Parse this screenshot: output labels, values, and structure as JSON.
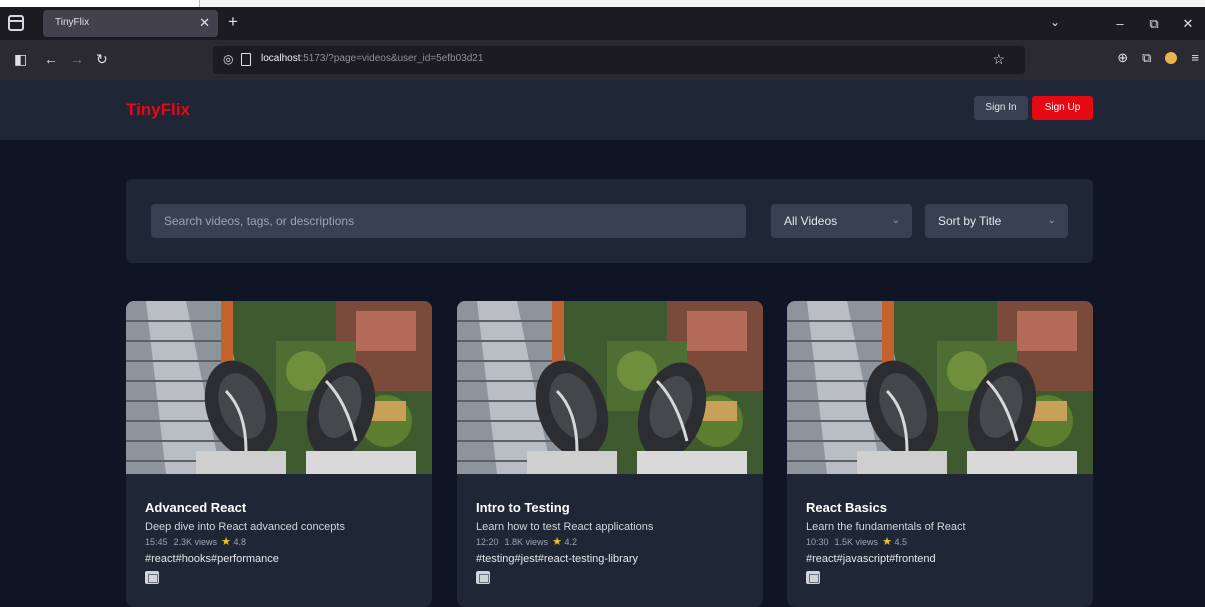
{
  "browser": {
    "tab_title": "TinyFlix",
    "tab_close": "✕",
    "new_tab": "+",
    "url_host": "localhost",
    "url_path": ":5173/?page=videos&user_id=5efb03d21",
    "controls": {
      "chevron": "⌄",
      "minimize": "–",
      "restore": "⧉",
      "close": "✕"
    }
  },
  "app": {
    "logo": "TinyFlix",
    "sign_in_label": "Sign In",
    "sign_up_label": "Sign Up"
  },
  "filters": {
    "search_placeholder": "Search videos, tags, or descriptions",
    "search_value": "",
    "category_selected": "All Videos",
    "sort_selected": "Sort by Title"
  },
  "videos": [
    {
      "title": "Advanced React",
      "description": "Deep dive into React advanced concepts",
      "duration": "15:45",
      "views": "2.3K views",
      "rating": "4.8",
      "tags": "#react#hooks#performance"
    },
    {
      "title": "Intro to Testing",
      "description": "Learn how to test React applications",
      "duration": "12:20",
      "views": "1.8K views",
      "rating": "4.2",
      "tags": "#testing#jest#react-testing-library"
    },
    {
      "title": "React Basics",
      "description": "Learn the fundamentals of React",
      "duration": "10:30",
      "views": "1.5K views",
      "rating": "4.5",
      "tags": "#react#javascript#frontend"
    }
  ],
  "colors": {
    "accent": "#e50914",
    "background": "#0f1524",
    "panel": "#1f2736",
    "star": "#f5c518"
  },
  "icons": {
    "star": "★",
    "thumbnail": "sneakers-over-city-photo",
    "card_action": "image-icon"
  }
}
